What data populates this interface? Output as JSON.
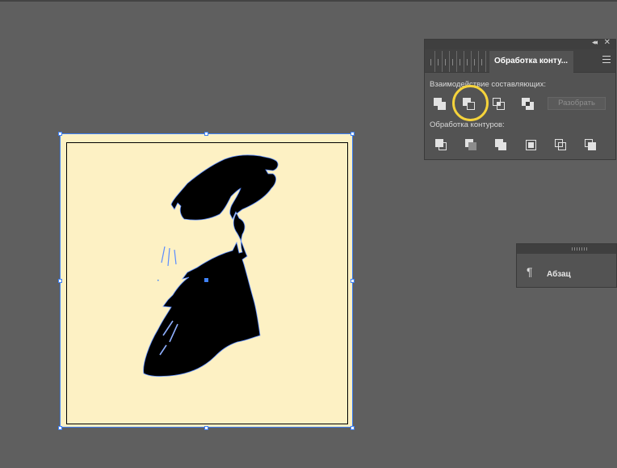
{
  "pathfinder_panel": {
    "tab_title": "Обработка конту...",
    "shape_modes_label": "Взаимодействие составляющих:",
    "expand_button_label": "Разобрать",
    "pathfinders_label": "Обработка контуров:",
    "collapse_glyph": "◂◂",
    "close_glyph": "✕"
  },
  "paragraph_panel": {
    "icon_glyph": "¶",
    "label": "Абзац"
  },
  "colors": {
    "canvas_bg": "#5f5f5f",
    "artboard_fill": "#fdf1c4",
    "selection_blue": "#3f82f7",
    "highlight_yellow": "#f5d33b",
    "silhouette": "#000000"
  }
}
